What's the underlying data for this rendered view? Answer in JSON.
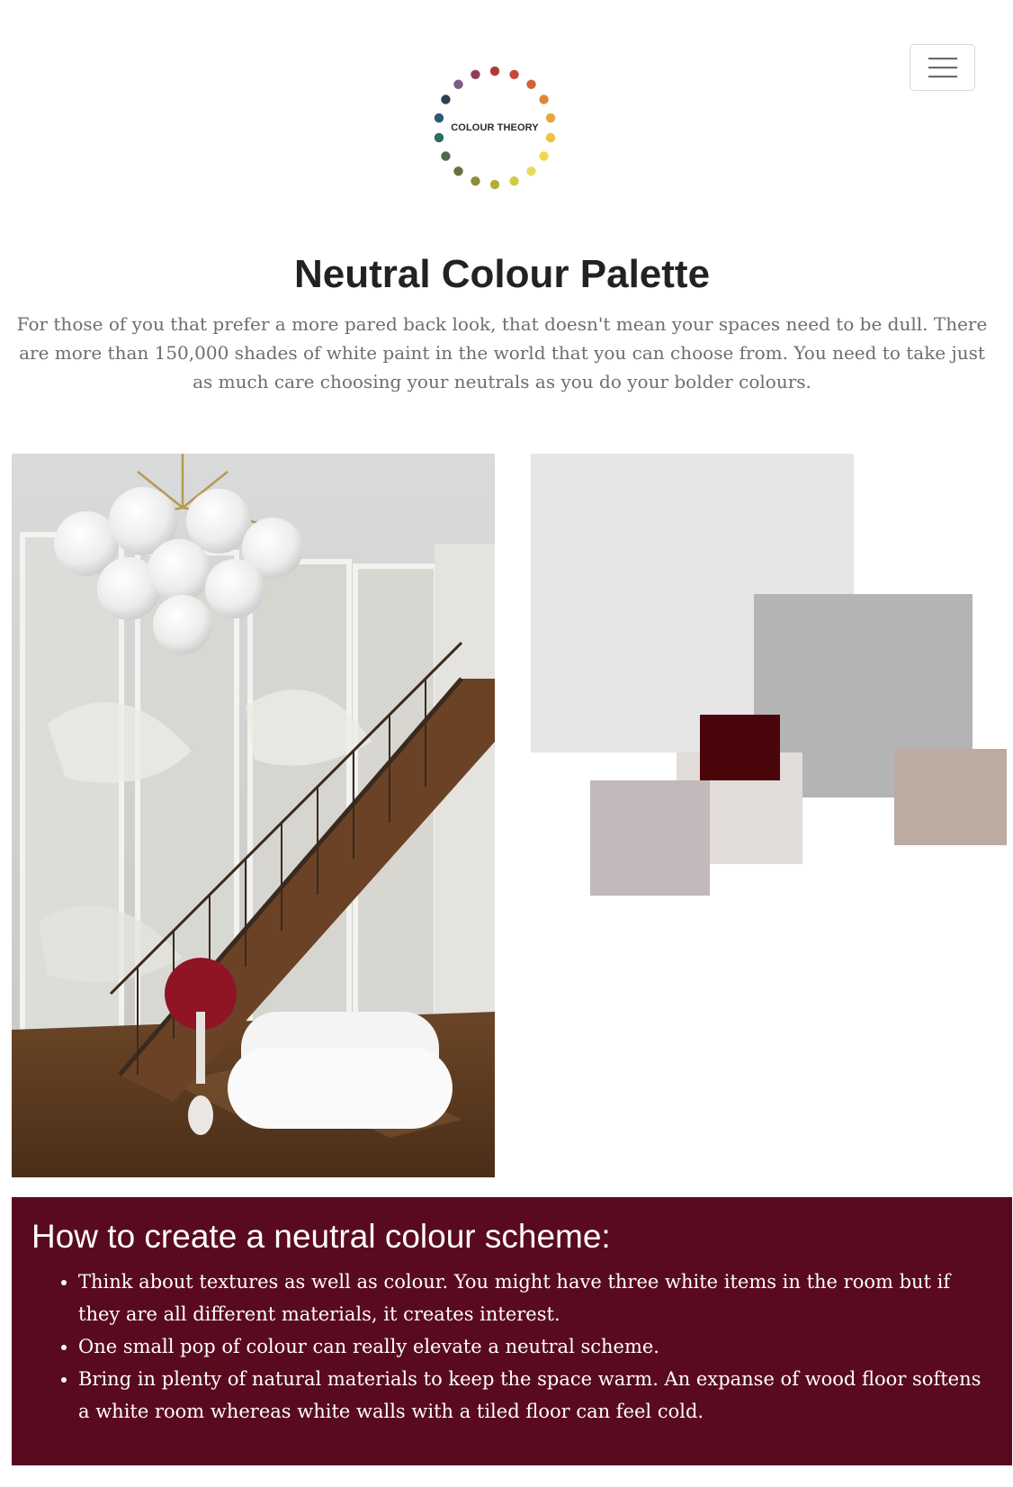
{
  "logo": {
    "text": "COLOUR THEORY",
    "icon": "colour-wheel-logo"
  },
  "nav": {
    "menu_icon": "hamburger-menu-icon"
  },
  "section": {
    "title": "Neutral Colour Palette",
    "intro": "For those of you that prefer a more pared back look, that doesn't mean your spaces need to be dull. There are more than 150,000 shades of white paint in the world that you can choose from. You need to take just as much care choosing your neutrals as you do your bolder colours."
  },
  "palette": {
    "colors": [
      "#e6e6e7",
      "#b4b4b5",
      "#4a050b",
      "#e2dcda",
      "#c4b9ba",
      "#bcaba1"
    ]
  },
  "tips": {
    "heading": "How to create a neutral colour scheme:",
    "items": [
      "Think about textures as well as colour. You might have three white items in the room but if they are all different materials, it creates interest.",
      "One small pop of colour can really elevate a neutral scheme.",
      "Bring in plenty of natural materials to keep the space warm. An expanse of wood floor softens a white room whereas white walls with a tiled floor can feel cold."
    ],
    "background": "#5a0a1f"
  }
}
